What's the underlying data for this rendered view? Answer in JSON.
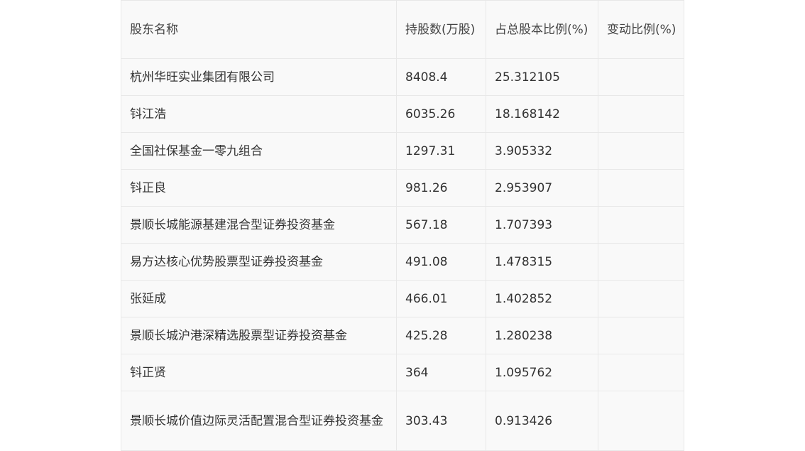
{
  "table": {
    "headers": {
      "name": "股东名称",
      "shares": "持股数(万股)",
      "ratio": "占总股本比例(%)",
      "change": "变动比例(%)"
    },
    "rows": [
      {
        "name": "杭州华旺实业集团有限公司",
        "shares": "8408.4",
        "ratio": "25.312105",
        "change": ""
      },
      {
        "name": "钭江浩",
        "shares": "6035.26",
        "ratio": "18.168142",
        "change": ""
      },
      {
        "name": "全国社保基金一零九组合",
        "shares": "1297.31",
        "ratio": "3.905332",
        "change": ""
      },
      {
        "name": "钭正良",
        "shares": "981.26",
        "ratio": "2.953907",
        "change": ""
      },
      {
        "name": "景顺长城能源基建混合型证券投资基金",
        "shares": "567.18",
        "ratio": "1.707393",
        "change": ""
      },
      {
        "name": "易方达核心优势股票型证券投资基金",
        "shares": "491.08",
        "ratio": "1.478315",
        "change": ""
      },
      {
        "name": "张延成",
        "shares": "466.01",
        "ratio": "1.402852",
        "change": ""
      },
      {
        "name": "景顺长城沪港深精选股票型证券投资基金",
        "shares": "425.28",
        "ratio": "1.280238",
        "change": ""
      },
      {
        "name": "钭正贤",
        "shares": "364",
        "ratio": "1.095762",
        "change": ""
      },
      {
        "name": "景顺长城价值边际灵活配置混合型证券投资基金",
        "shares": "303.43",
        "ratio": "0.913426",
        "change": ""
      }
    ]
  }
}
